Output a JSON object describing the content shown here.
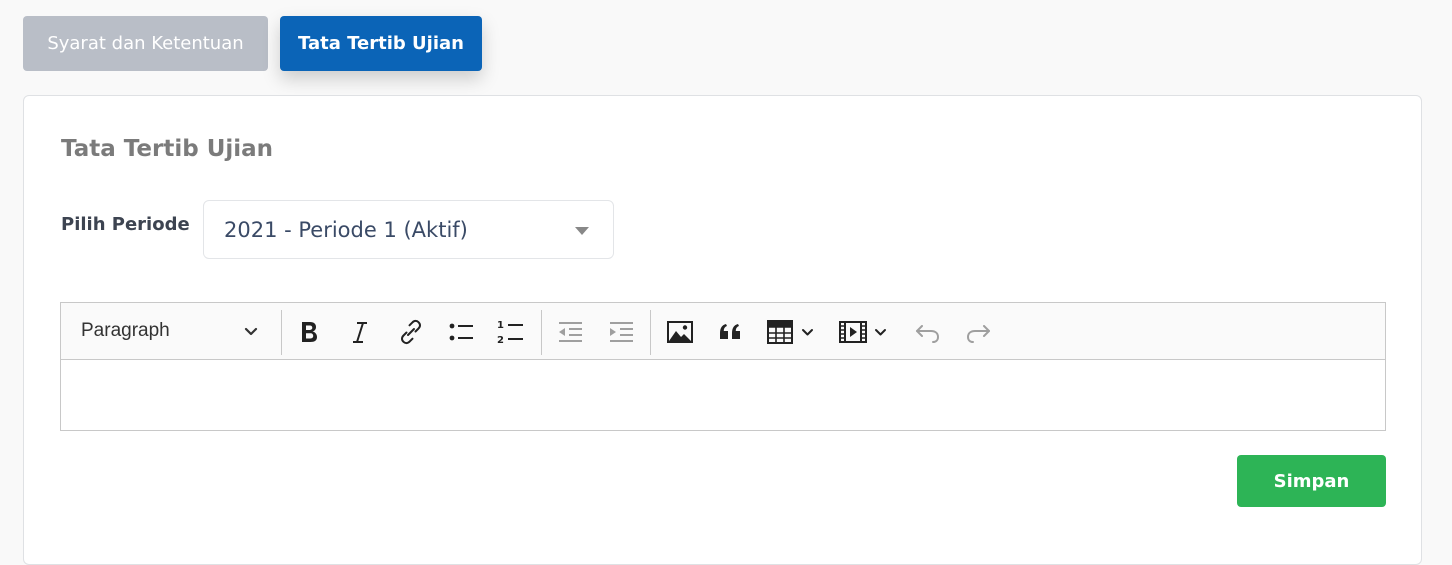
{
  "tabs": [
    {
      "label": "Syarat dan Ketentuan",
      "active": false
    },
    {
      "label": "Tata Tertib Ujian",
      "active": true
    }
  ],
  "card": {
    "title": "Tata Tertib Ujian",
    "periode_label": "Pilih Periode",
    "periode_value": "2021 - Periode 1 (Aktif)"
  },
  "editor": {
    "heading_dropdown": "Paragraph",
    "toolbar_icons": [
      "bold-icon",
      "italic-icon",
      "link-icon",
      "bulleted-list-icon",
      "numbered-list-icon",
      "outdent-icon",
      "indent-icon",
      "image-icon",
      "blockquote-icon",
      "table-icon",
      "media-icon",
      "undo-icon",
      "redo-icon"
    ],
    "content": ""
  },
  "actions": {
    "save_label": "Simpan"
  },
  "colors": {
    "active_tab": "#0b64b7",
    "inactive_tab": "#b9bec7",
    "save_button": "#2db456"
  }
}
